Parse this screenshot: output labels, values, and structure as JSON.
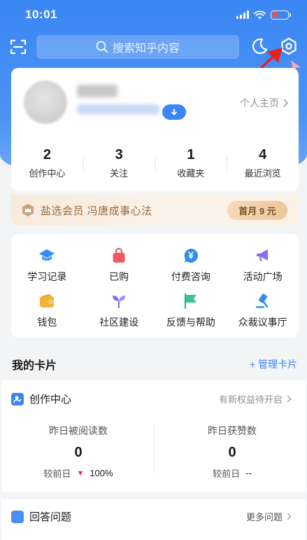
{
  "status_bar": {
    "time": "10:01"
  },
  "search": {
    "placeholder": "搜索知乎内容"
  },
  "profile": {
    "homepage_label": "个人主页",
    "stats": [
      {
        "value": "2",
        "label": "创作中心"
      },
      {
        "value": "3",
        "label": "关注"
      },
      {
        "value": "1",
        "label": "收藏夹"
      },
      {
        "value": "4",
        "label": "最近浏览"
      }
    ]
  },
  "vip": {
    "text": "盐选会员 冯唐成事心法",
    "button": "首月 9 元"
  },
  "grid": {
    "items": [
      {
        "label": "学习记录",
        "icon": "graduation-cap-icon"
      },
      {
        "label": "已购",
        "icon": "shopping-bag-icon"
      },
      {
        "label": "付费咨询",
        "icon": "yuan-chat-icon"
      },
      {
        "label": "活动广场",
        "icon": "megaphone-icon"
      },
      {
        "label": "钱包",
        "icon": "wallet-icon"
      },
      {
        "label": "社区建设",
        "icon": "sprout-icon"
      },
      {
        "label": "反馈与帮助",
        "icon": "flag-icon"
      },
      {
        "label": "众裁议事厅",
        "icon": "gavel-icon"
      }
    ]
  },
  "cards": {
    "title": "我的卡片",
    "manage_label": "+ 管理卡片",
    "creation": {
      "title": "创作中心",
      "right_link": "有新权益待开启",
      "metrics": [
        {
          "label": "昨日被阅读数",
          "value": "0",
          "compare_label": "较前日",
          "compare_value": "100%",
          "trend": "down"
        },
        {
          "label": "昨日获赞数",
          "value": "0",
          "compare_label": "较前日",
          "compare_value": "--"
        }
      ]
    },
    "answer": {
      "title": "回答问题",
      "right_link": "更多问题"
    }
  },
  "colors": {
    "brand_blue": "#3a86f3",
    "vip_gold": "#9a6a3c",
    "alert_red": "#e8313a"
  }
}
